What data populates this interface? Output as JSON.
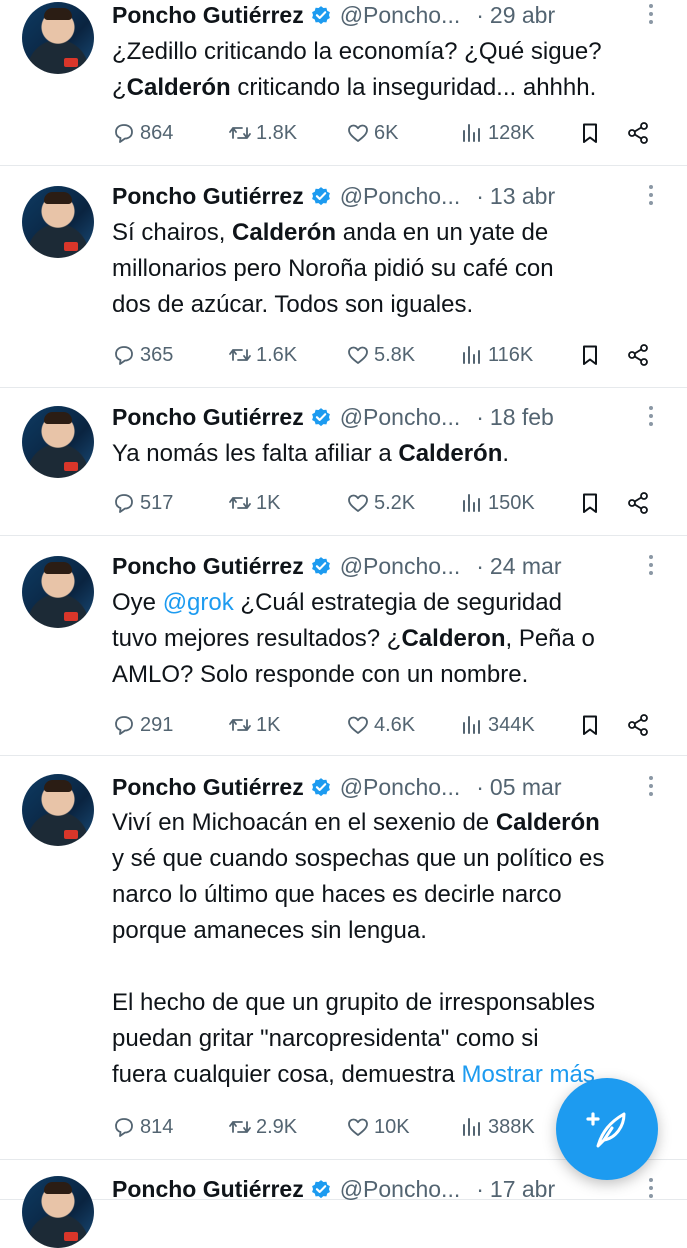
{
  "icons": {
    "reply": "reply-icon",
    "retweet": "retweet-icon",
    "like": "heart-icon",
    "views": "views-icon",
    "bookmark": "bookmark-icon",
    "share": "share-icon",
    "more": "more-icon",
    "verified": "verified-badge-icon",
    "compose": "compose-icon"
  },
  "colors": {
    "accent": "#1d9bf0",
    "text": "#0f1419",
    "muted": "#536471"
  },
  "tweets": [
    {
      "name": "Poncho Gutiérrez",
      "handle": "@Poncho...",
      "date": "29 abr",
      "text": [
        "¿Zedillo criticando la economía? ¿Qué sigue?\n¿",
        {
          "b": "Calderón"
        },
        " criticando la inseguridad... ahhhh."
      ],
      "replies": "864",
      "retweets": "1.8K",
      "likes": "6K",
      "views": "128K"
    },
    {
      "name": "Poncho Gutiérrez",
      "handle": "@Poncho...",
      "date": "13 abr",
      "text": [
        "Sí chairos, ",
        {
          "b": "Calderón"
        },
        " anda en un yate de\nmillonarios pero Noroña pidió su café con\ndos de azúcar. Todos son iguales."
      ],
      "replies": "365",
      "retweets": "1.6K",
      "likes": "5.8K",
      "views": "116K"
    },
    {
      "name": "Poncho Gutiérrez",
      "handle": "@Poncho...",
      "date": "18 feb",
      "text": [
        "Ya nomás les falta afiliar a ",
        {
          "b": "Calderón"
        },
        "."
      ],
      "replies": "517",
      "retweets": "1K",
      "likes": "5.2K",
      "views": "150K"
    },
    {
      "name": "Poncho Gutiérrez",
      "handle": "@Poncho...",
      "date": "24 mar",
      "text": [
        "Oye ",
        {
          "m": "@grok"
        },
        "  ¿Cuál estrategia de seguridad\ntuvo mejores resultados? ¿",
        {
          "b": "Calderon"
        },
        ", Peña o\nAMLO? Solo responde con un nombre."
      ],
      "replies": "291",
      "retweets": "1K",
      "likes": "4.6K",
      "views": "344K"
    },
    {
      "name": "Poncho Gutiérrez",
      "handle": "@Poncho...",
      "date": "05 mar",
      "text": [
        "Viví en Michoacán en el sexenio de ",
        {
          "b": "Calderón"
        },
        "\ny sé que cuando sospechas que un político es\nnarco lo último que haces es decirle narco\nporque amaneces sin lengua.\n\nEl hecho de que un grupito de irresponsables\npuedan gritar \"narcopresidenta\" como si\nfuera cualquier cosa, demuestra ",
        {
          "l": "Mostrar más"
        }
      ],
      "replies": "814",
      "retweets": "2.9K",
      "likes": "10K",
      "views": "388K"
    },
    {
      "name": "Poncho Gutiérrez",
      "handle": "@Poncho...",
      "date": "17 abr",
      "text": [],
      "replies": "",
      "retweets": "",
      "likes": "",
      "views": ""
    }
  ]
}
